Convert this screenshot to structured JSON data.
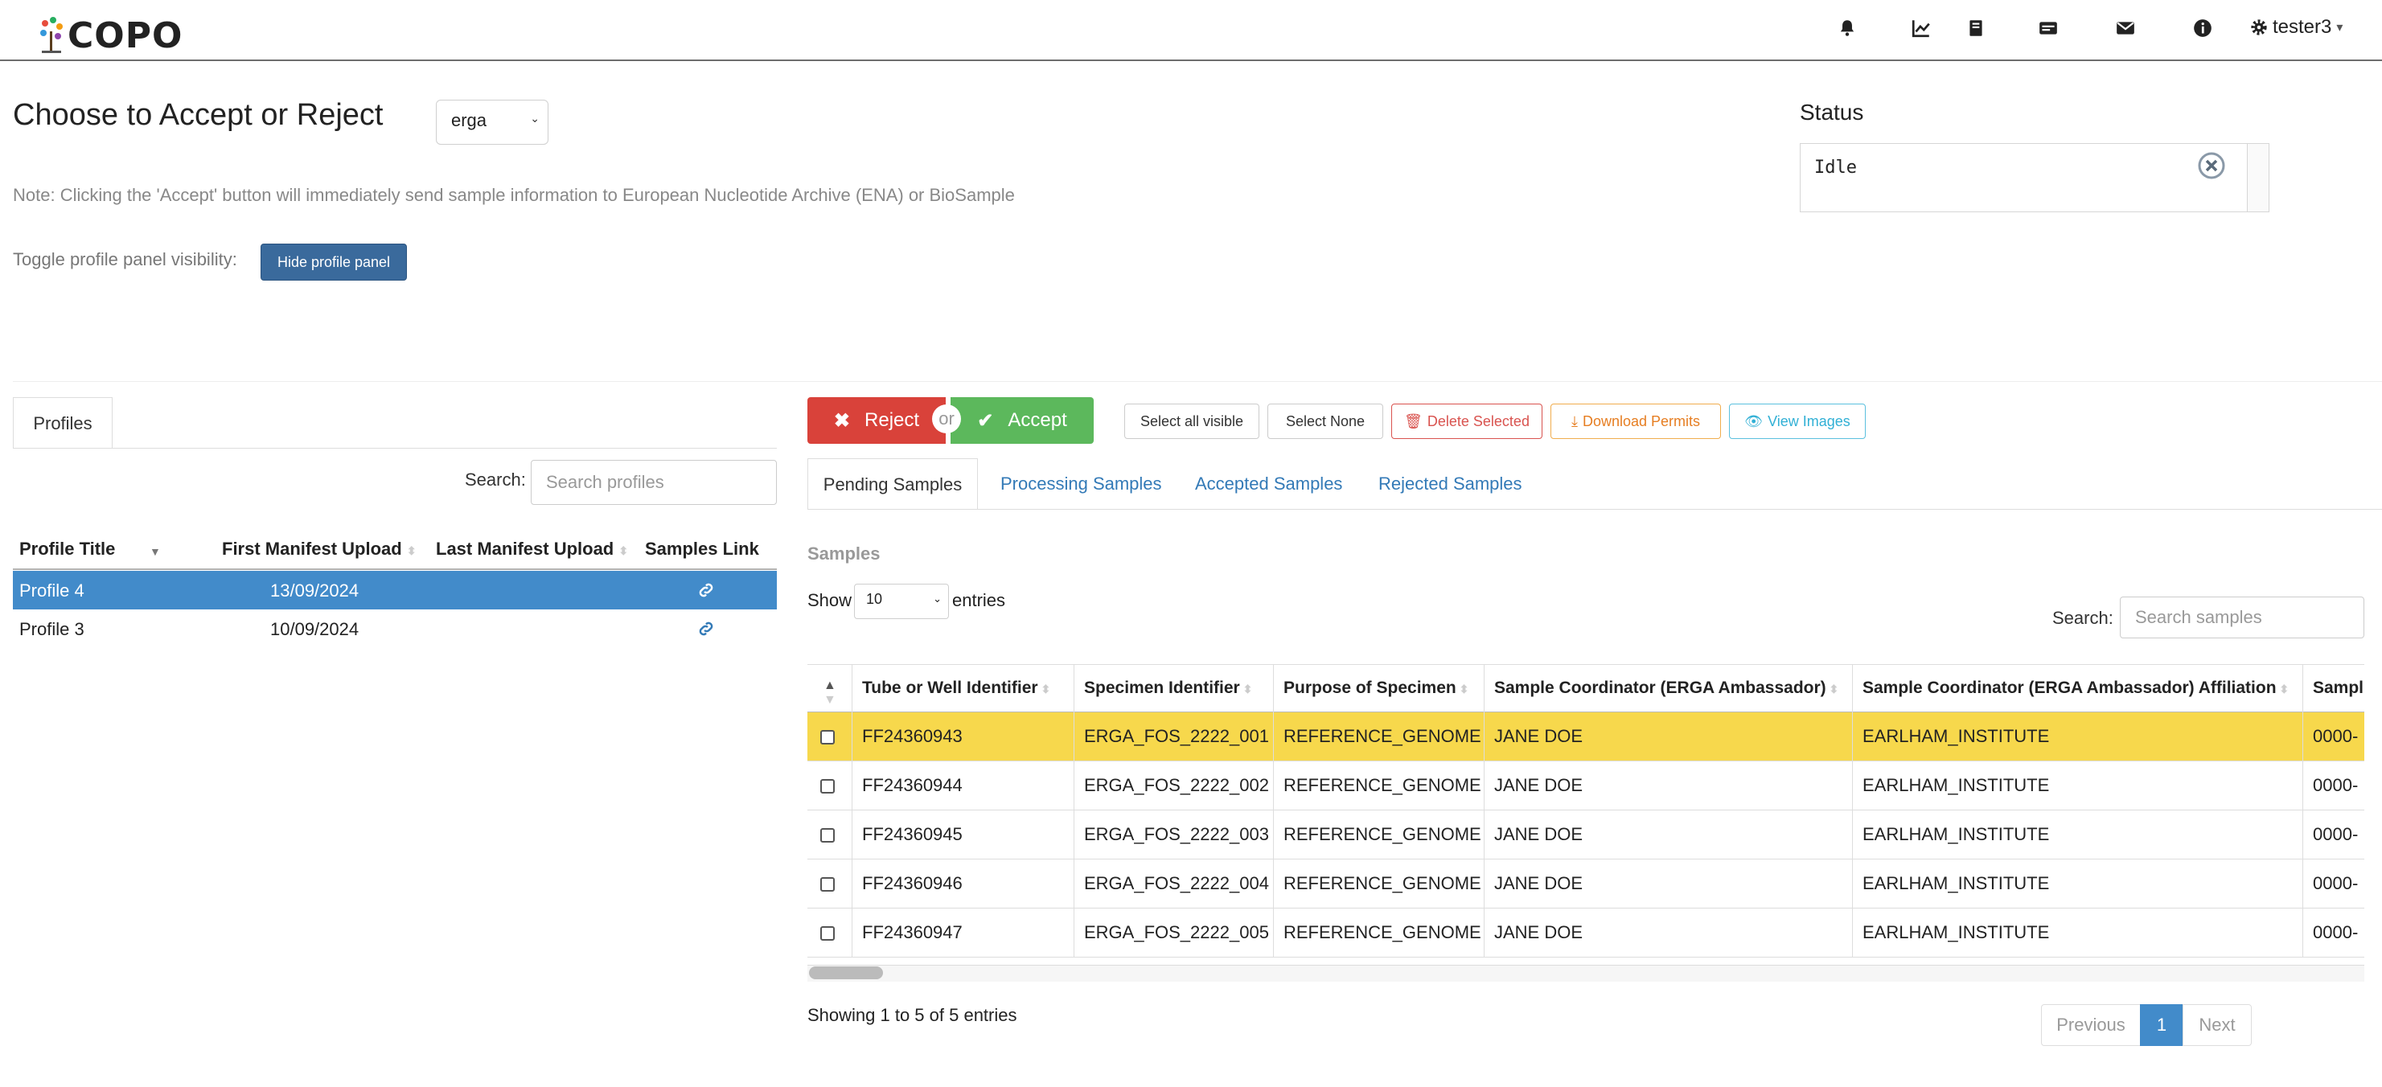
{
  "navbar": {
    "brand": "COPO",
    "icons": [
      "bell-icon",
      "chart-line-icon",
      "book-icon",
      "id-card-icon",
      "envelope-icon",
      "info-circle-icon"
    ],
    "user": {
      "icon": "gear-icon",
      "name": "tester3",
      "caret": "▾"
    }
  },
  "header": {
    "title": "Choose to Accept or Reject",
    "profile_type": "erga",
    "note": "Note: Clicking the 'Accept' button will immediately send sample information to European Nucleotide Archive (ENA) or BioSample",
    "toggle_label": "Toggle profile panel visibility:",
    "hide_panel_button": "Hide profile panel"
  },
  "status": {
    "heading": "Status",
    "text": "Idle"
  },
  "profiles": {
    "tab_label": "Profiles",
    "search_label": "Search:",
    "search_placeholder": "Search profiles",
    "columns": [
      "Profile Title",
      "First Manifest Upload",
      "Last Manifest Upload",
      "Samples Link"
    ],
    "rows": [
      {
        "title": "Profile 4",
        "first_upload": "13/09/2024",
        "last_upload": "",
        "selected": true
      },
      {
        "title": "Profile 3",
        "first_upload": "10/09/2024",
        "last_upload": "",
        "selected": false
      }
    ]
  },
  "actions": {
    "reject": "Reject",
    "or": "or",
    "accept": "Accept",
    "select_all": "Select all visible",
    "select_none": "Select None",
    "delete": "Delete Selected",
    "download": "Download Permits",
    "view_images": "View Images"
  },
  "sample_tabs": [
    "Pending Samples",
    "Processing Samples",
    "Accepted Samples",
    "Rejected Samples"
  ],
  "samples": {
    "caption": "Samples",
    "show_label": "Show",
    "entries_value": "10",
    "entries_label": "entries",
    "search_label": "Search:",
    "search_placeholder": "Search samples",
    "columns": [
      "Tube or Well Identifier",
      "Specimen Identifier",
      "Purpose of Specimen",
      "Sample Coordinator (ERGA Ambassador)",
      "Sample Coordinator (ERGA Ambassador) Affiliation",
      "Sampl"
    ],
    "rows": [
      {
        "tube": "FF24360943",
        "specimen": "ERGA_FOS_2222_001",
        "purpose": "REFERENCE_GENOME",
        "coordinator": "JANE DOE",
        "affiliation": "EARLHAM_INSTITUTE",
        "next": "0000-"
      },
      {
        "tube": "FF24360944",
        "specimen": "ERGA_FOS_2222_002",
        "purpose": "REFERENCE_GENOME",
        "coordinator": "JANE DOE",
        "affiliation": "EARLHAM_INSTITUTE",
        "next": "0000-"
      },
      {
        "tube": "FF24360945",
        "specimen": "ERGA_FOS_2222_003",
        "purpose": "REFERENCE_GENOME",
        "coordinator": "JANE DOE",
        "affiliation": "EARLHAM_INSTITUTE",
        "next": "0000-"
      },
      {
        "tube": "FF24360946",
        "specimen": "ERGA_FOS_2222_004",
        "purpose": "REFERENCE_GENOME",
        "coordinator": "JANE DOE",
        "affiliation": "EARLHAM_INSTITUTE",
        "next": "0000-"
      },
      {
        "tube": "FF24360947",
        "specimen": "ERGA_FOS_2222_005",
        "purpose": "REFERENCE_GENOME",
        "coordinator": "JANE DOE",
        "affiliation": "EARLHAM_INSTITUTE",
        "next": "0000-"
      }
    ],
    "info": "Showing 1 to 5 of 5 entries",
    "pagination": {
      "previous": "Previous",
      "current": "1",
      "next": "Next"
    }
  },
  "colors": {
    "reject": "#d9423a",
    "accept": "#5cb85c",
    "selected_row": "#428bca",
    "highlight_row": "#f7d84c",
    "primary_button": "#3a6a9c"
  }
}
